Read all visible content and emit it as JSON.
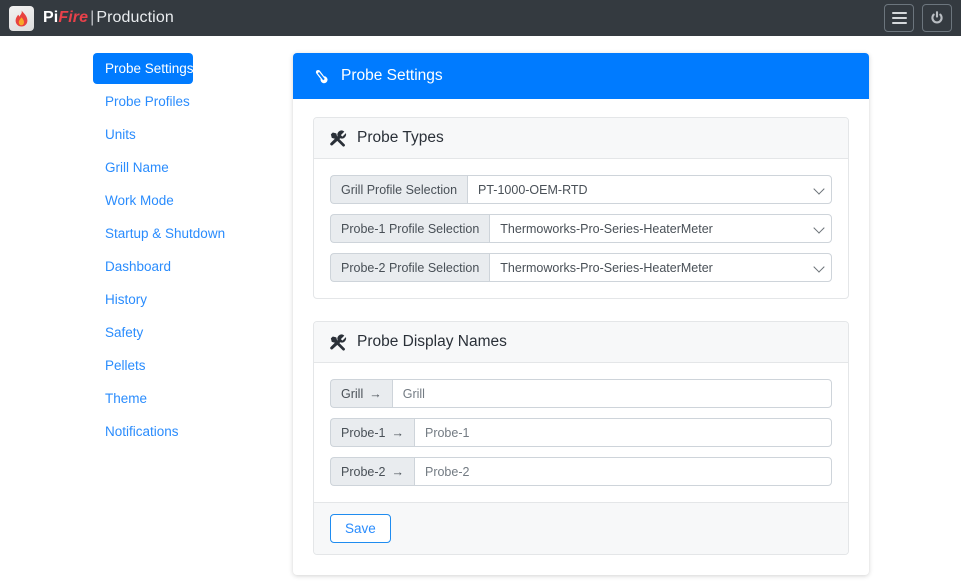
{
  "navbar": {
    "logo_icon": "flame-icon",
    "brand_pi": "Pi",
    "brand_fire": "Fire",
    "brand_separator": "|",
    "brand_environment": "Production",
    "menu_button_icon": "hamburger-icon",
    "power_button_icon": "power-icon",
    "background_color": "#343a40"
  },
  "sidebar": {
    "items": [
      {
        "label": "Probe Settings",
        "active": true
      },
      {
        "label": "Probe Profiles",
        "active": false
      },
      {
        "label": "Units",
        "active": false
      },
      {
        "label": "Grill Name",
        "active": false
      },
      {
        "label": "Work Mode",
        "active": false
      },
      {
        "label": "Startup & Shutdown",
        "active": false
      },
      {
        "label": "Dashboard",
        "active": false
      },
      {
        "label": "History",
        "active": false
      },
      {
        "label": "Safety",
        "active": false
      },
      {
        "label": "Pellets",
        "active": false
      },
      {
        "label": "Theme",
        "active": false
      },
      {
        "label": "Notifications",
        "active": false
      }
    ],
    "active_background_color": "#007bff",
    "link_color": "#2a8cfd"
  },
  "main": {
    "header": {
      "icon": "thermometer-icon",
      "title": "Probe Settings",
      "background_color": "#007bff"
    },
    "probe_types": {
      "icon": "tools-icon",
      "title": "Probe Types",
      "rows": [
        {
          "label": "Grill Profile Selection",
          "value": "PT-1000-OEM-RTD",
          "control": "select"
        },
        {
          "label": "Probe-1 Profile Selection",
          "value": "Thermoworks-Pro-Series-HeaterMeter",
          "control": "select"
        },
        {
          "label": "Probe-2 Profile Selection",
          "value": "Thermoworks-Pro-Series-HeaterMeter",
          "control": "select"
        }
      ]
    },
    "probe_display_names": {
      "icon": "tools-icon",
      "title": "Probe Display Names",
      "rows": [
        {
          "label": "Grill",
          "arrow": "→",
          "value": "Grill",
          "placeholder": "Grill",
          "control": "text"
        },
        {
          "label": "Probe-1",
          "arrow": "→",
          "value": "Probe-1",
          "placeholder": "Probe-1",
          "control": "text"
        },
        {
          "label": "Probe-2",
          "arrow": "→",
          "value": "Probe-2",
          "placeholder": "Probe-2",
          "control": "text"
        }
      ],
      "save_label": "Save"
    }
  }
}
